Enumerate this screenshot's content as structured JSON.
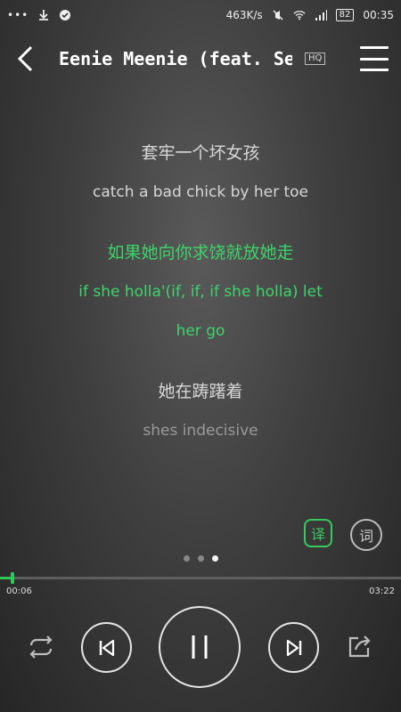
{
  "status_bar": {
    "dots": "•••",
    "speed": "463K/s",
    "battery": "82",
    "time": "00:35"
  },
  "header": {
    "title": "Eenie Meenie (feat. Sean",
    "quality_badge": "HQ"
  },
  "lyrics": [
    {
      "text": "套牢一个坏女孩",
      "style": "normal"
    },
    {
      "text": "catch a bad chick by her toe",
      "style": "normal"
    },
    {
      "text": "如果她向你求饶就放她走",
      "style": "active"
    },
    {
      "text": "if she holla'(if, if, if she holla) let",
      "style": "active"
    },
    {
      "text": "her go",
      "style": "active"
    },
    {
      "text": "她在踌躇着",
      "style": "normal"
    },
    {
      "text": "shes indecisive",
      "style": "dim"
    }
  ],
  "side_buttons": {
    "translate_label": "译",
    "words_label": "词"
  },
  "pager": {
    "count": 3,
    "active": 2
  },
  "playback": {
    "current_time": "00:06",
    "total_time": "03:22",
    "progress": 0.03
  },
  "colors": {
    "accent": "#3dd46b",
    "text": "#d7d7d7"
  },
  "icons": [
    "back-arrow-icon",
    "menu-icon",
    "repeat-icon",
    "previous-icon",
    "pause-icon",
    "next-icon",
    "share-icon"
  ]
}
